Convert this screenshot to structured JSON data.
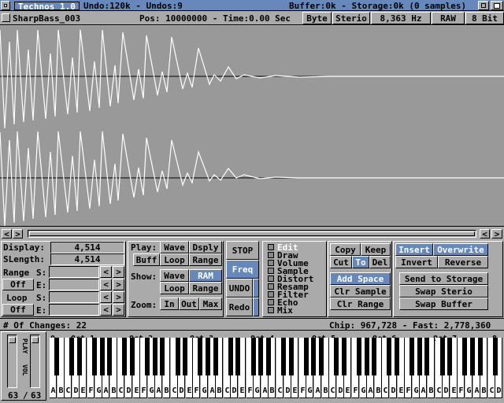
{
  "titlebar": {
    "title": "Technos 1.0",
    "undo": "Undo:120k - Undos:9",
    "buffer": "Buffer:0k - Storage:0k (0 samples)"
  },
  "infobar": {
    "sample_name": "SharpBass_003",
    "position": "Pos: 10000000 - Time:0.00 Sec",
    "byte": "Byte",
    "sterio": "Sterio",
    "rate": "8,363 Hz",
    "raw": "RAW",
    "bits": "8 Bit"
  },
  "info": {
    "display_label": "Display:",
    "display_value": "4,514",
    "slength_label": "SLength:",
    "slength_value": "4,514",
    "range_label": "Range",
    "range_state": "Off",
    "loop_label": "Loop",
    "loop_state": "Off",
    "s_label": "S:",
    "e_label": "E:",
    "prev": "<",
    "next": ">"
  },
  "play": {
    "play_label": "Play:",
    "wave": "Wave",
    "dsply": "Dsply",
    "buff": "Buff",
    "loop": "Loop",
    "range": "Range",
    "show_label": "Show:",
    "show_wave": "Wave",
    "ram": "RAM",
    "show_loop": "Loop",
    "show_range": "Range",
    "zoom_label": "Zoom:",
    "zoom_in": "In",
    "zoom_out": "Out",
    "zoom_max": "Max"
  },
  "transport": {
    "stop": "STOP",
    "freq": "Freq",
    "undo": "UNDO",
    "redo": "Redo"
  },
  "tools": [
    "Edit",
    "Draw",
    "Volume",
    "Sample",
    "Distort",
    "Resamp",
    "Filter",
    "Echo",
    "Mix"
  ],
  "edit": {
    "copy": "Copy",
    "keep": "Keep",
    "cut": "Cut",
    "to": "To",
    "del": "Del",
    "add_space": "Add Space",
    "clr_sample": "Clr Sample",
    "clr_range": "Clr Range",
    "insert": "Insert",
    "overwrite": "Overwrite",
    "invert": "Invert",
    "reverse": "Reverse",
    "send": "Send to Storage",
    "swap_sterio": "Swap Sterio",
    "swap_buffer": "Swap Buffer"
  },
  "status": {
    "changes": "# Of Changes: 22",
    "memory": "Chip: 967,728 - Fast: 2,778,360"
  },
  "keyboard": {
    "vol_left": "63",
    "vol_sep": "/",
    "vol_right": "63",
    "play_label": "PLAY",
    "vol_label": "VOL",
    "octaves": [
      "0",
      "Oct 1",
      "Oct 2",
      "Oct 3",
      "Oct 4",
      "Oct 5",
      "Oct 6",
      "Oct 7",
      "8"
    ],
    "notes": [
      "A",
      "B",
      "C",
      "D",
      "E",
      "F",
      "G",
      "A",
      "B",
      "C",
      "D",
      "E",
      "F",
      "G",
      "A",
      "B",
      "C",
      "D",
      "E",
      "F",
      "G",
      "A",
      "B",
      "C",
      "D",
      "E",
      "F",
      "G",
      "A",
      "B",
      "C",
      "D",
      "E",
      "F",
      "G",
      "A",
      "B",
      "C",
      "D",
      "E",
      "F",
      "G",
      "A",
      "B",
      "C",
      "D",
      "E",
      "F",
      "G",
      "A",
      "B",
      "C",
      "D",
      "E",
      "F",
      "G",
      "A",
      "B",
      "C",
      "D"
    ]
  },
  "colors": {
    "bg": "#aaaaaa",
    "accent": "#6688bb",
    "wave_bg": "#999999",
    "wave_line": "#ffffff"
  }
}
